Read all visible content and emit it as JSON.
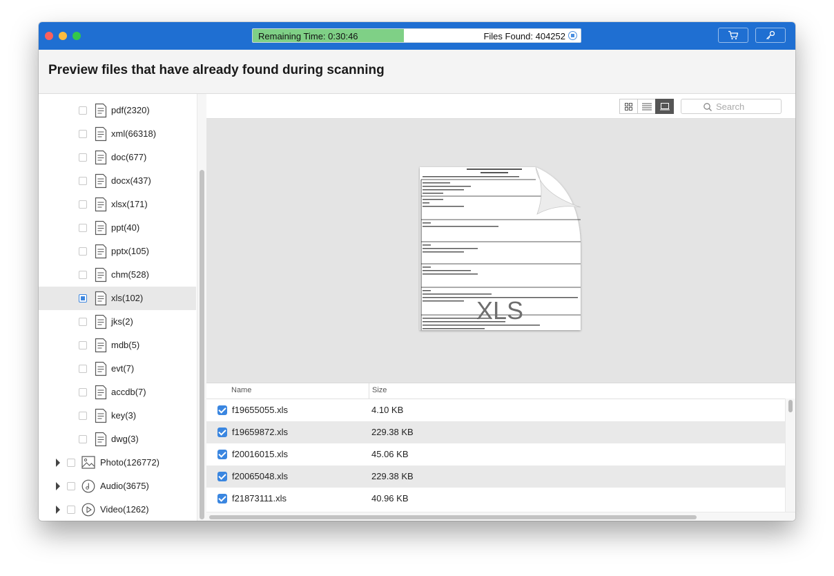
{
  "titlebar": {
    "remaining_time": "Remaining Time: 0:30:46",
    "files_found": "Files Found: 404252",
    "progress_fraction": 0.46
  },
  "header": {
    "title": "Preview files that have already found during scanning"
  },
  "sidebar": {
    "file_types": [
      {
        "label": "pdf(2320)",
        "checked": false
      },
      {
        "label": "xml(66318)",
        "checked": false
      },
      {
        "label": "doc(677)",
        "checked": false
      },
      {
        "label": "docx(437)",
        "checked": false
      },
      {
        "label": "xlsx(171)",
        "checked": false
      },
      {
        "label": "ppt(40)",
        "checked": false
      },
      {
        "label": "pptx(105)",
        "checked": false
      },
      {
        "label": "chm(528)",
        "checked": false
      },
      {
        "label": "xls(102)",
        "checked": true
      },
      {
        "label": "jks(2)",
        "checked": false
      },
      {
        "label": "mdb(5)",
        "checked": false
      },
      {
        "label": "evt(7)",
        "checked": false
      },
      {
        "label": "accdb(7)",
        "checked": false
      },
      {
        "label": "key(3)",
        "checked": false
      },
      {
        "label": "dwg(3)",
        "checked": false
      }
    ],
    "categories": [
      {
        "label": "Photo(126772)",
        "icon": "photo-icon"
      },
      {
        "label": "Audio(3675)",
        "icon": "audio-icon"
      },
      {
        "label": "Video(1262)",
        "icon": "video-icon"
      }
    ]
  },
  "toolbar": {
    "search_placeholder": "Search"
  },
  "preview": {
    "file_type_label": "XLS"
  },
  "table": {
    "columns": {
      "name": "Name",
      "size": "Size"
    },
    "rows": [
      {
        "name": "f19655055.xls",
        "size": "4.10 KB"
      },
      {
        "name": "f19659872.xls",
        "size": "229.38 KB"
      },
      {
        "name": "f20016015.xls",
        "size": "45.06 KB"
      },
      {
        "name": "f20065048.xls",
        "size": "229.38 KB"
      },
      {
        "name": "f21873111.xls",
        "size": "40.96 KB"
      }
    ]
  },
  "colors": {
    "titlebar": "#1f6fd2",
    "progress": "#7fd086",
    "accent": "#3a86e0"
  }
}
